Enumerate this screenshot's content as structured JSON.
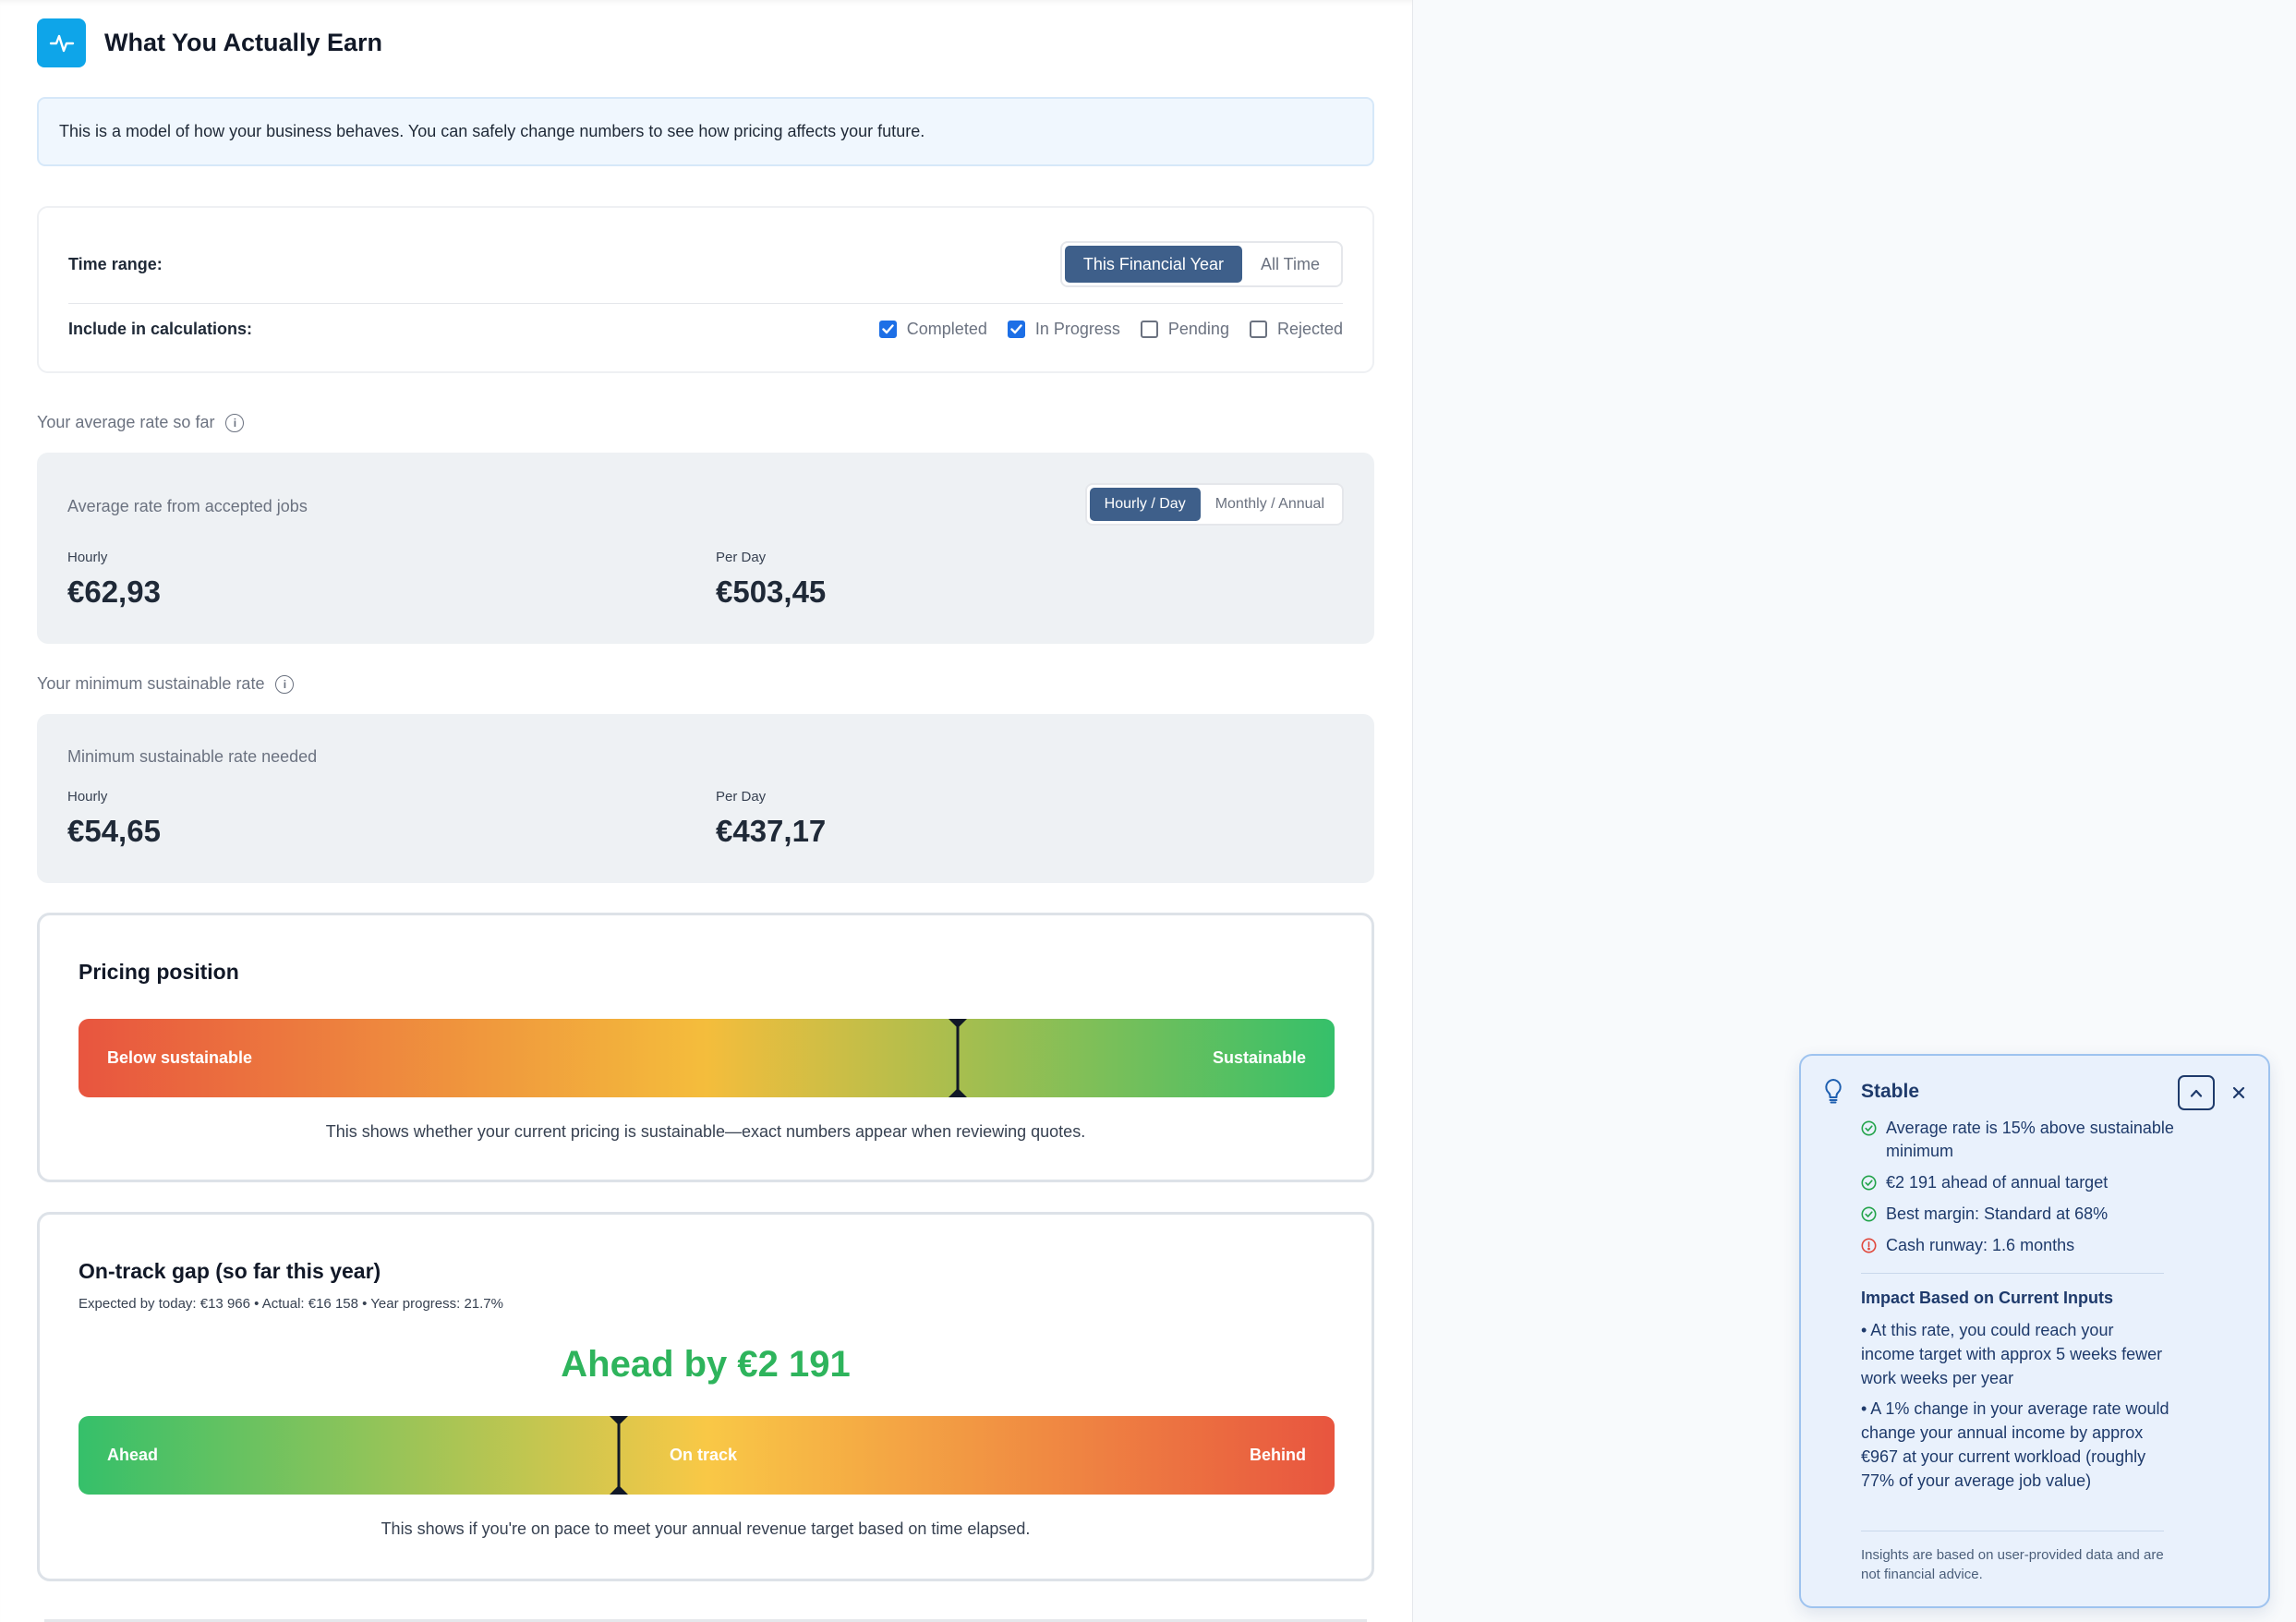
{
  "header": {
    "title": "What You Actually Earn",
    "icon": "activity-icon"
  },
  "banner": {
    "text": "This is a model of how your business behaves. You can safely change numbers to see how pricing affects your future."
  },
  "filters": {
    "time_range_label": "Time range:",
    "time_range_options": [
      "This Financial Year",
      "All Time"
    ],
    "time_range_selected": "This Financial Year",
    "include_label": "Include in calculations:",
    "include_options": [
      {
        "label": "Completed",
        "checked": true
      },
      {
        "label": "In Progress",
        "checked": true
      },
      {
        "label": "Pending",
        "checked": false
      },
      {
        "label": "Rejected",
        "checked": false
      }
    ]
  },
  "average_rate": {
    "section_label": "Your average rate so far",
    "card_title": "Average rate from accepted jobs",
    "toggle_options": [
      "Hourly / Day",
      "Monthly / Annual"
    ],
    "toggle_selected": "Hourly / Day",
    "hourly_label": "Hourly",
    "hourly_value": "€62,93",
    "day_label": "Per Day",
    "day_value": "€503,45"
  },
  "minimum_rate": {
    "section_label": "Your minimum sustainable rate",
    "card_title": "Minimum sustainable rate needed",
    "hourly_label": "Hourly",
    "hourly_value": "€54,65",
    "day_label": "Per Day",
    "day_value": "€437,17"
  },
  "pricing_position": {
    "title": "Pricing position",
    "left_label": "Below sustainable",
    "right_label": "Sustainable",
    "marker_position": 0.7,
    "note": "This shows whether your current pricing is sustainable—exact numbers appear when reviewing quotes.",
    "colors": {
      "low": "#e8553f",
      "mid": "#f4bd3c",
      "high": "#35c06a"
    }
  },
  "on_track": {
    "title": "On-track gap (so far this year)",
    "meta": "Expected by today: €13 966 • Actual: €16 158 • Year progress: 21.7%",
    "headline": "Ahead by €2 191",
    "left_label": "Ahead",
    "mid_label": "On track",
    "right_label": "Behind",
    "marker_position": 0.43,
    "note": "This shows if you're on pace to meet your annual revenue target based on time elapsed.",
    "colors": {
      "ahead": "#35c06a",
      "track": "#f9c846",
      "behind": "#e8553f",
      "headline": "#2eb45c"
    }
  },
  "insights": {
    "title": "Stable",
    "items": [
      {
        "text": "Average rate is 15% above sustainable minimum",
        "status": "ok"
      },
      {
        "text": "€2 191 ahead of annual target",
        "status": "ok"
      },
      {
        "text": "Best margin: Standard at 68%",
        "status": "ok"
      },
      {
        "text": "Cash runway: 1.6 months",
        "status": "warn"
      }
    ],
    "impact_title": "Impact Based on Current Inputs",
    "impact_bullets": [
      "• At this rate, you could reach your income target with approx 5 weeks fewer work weeks per year",
      "• A 1% change in your average rate would change your annual income by approx €967 at your current workload (roughly 77% of your average job value)"
    ],
    "footer": "Insights are based on user-provided data and are not financial advice."
  }
}
